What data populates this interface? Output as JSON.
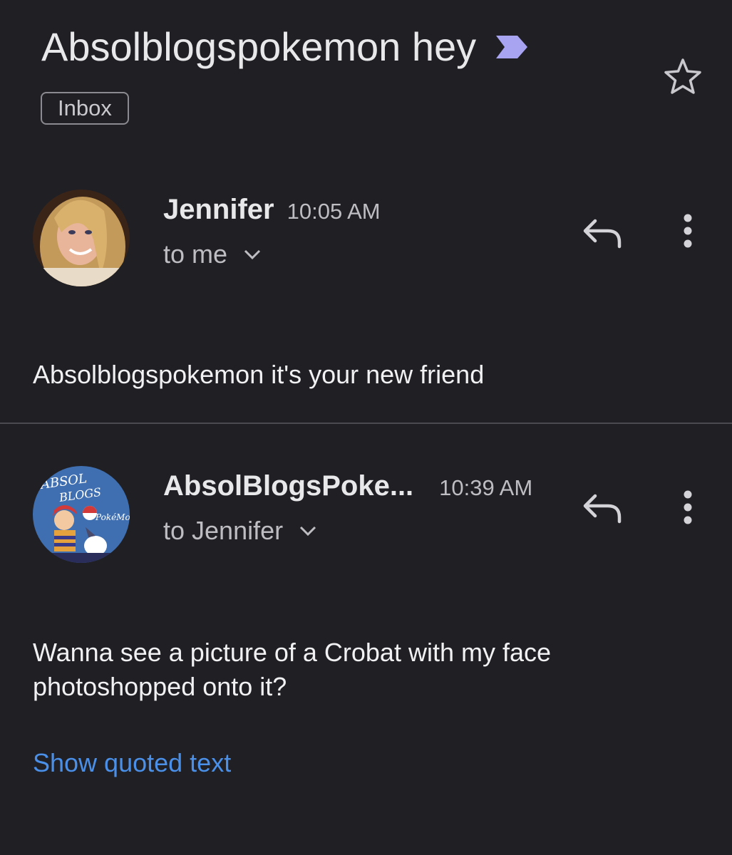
{
  "thread": {
    "subject": "Absolblogspokemon hey",
    "label": "Inbox"
  },
  "messages": [
    {
      "sender": "Jennifer",
      "time": "10:05 AM",
      "recipient": "to me",
      "body": "Absolblogspokemon it's your new friend"
    },
    {
      "sender": "AbsolBlogsPoke...",
      "time": "10:39 AM",
      "recipient": "to Jennifer",
      "body": "Wanna see a picture of a Crobat with my face photoshopped onto it?",
      "quoted_link": "Show quoted text",
      "avatar_logo": "ABSOL BLOGS PokéMon"
    }
  ],
  "icons": {
    "importance": "importance-marker-icon",
    "star": "star-icon",
    "reply": "reply-icon",
    "more": "more-vert-icon",
    "expand": "chevron-down-icon"
  },
  "colors": {
    "background": "#1f1f24",
    "importance": "#a9a4f2",
    "link": "#4a8fe8"
  }
}
